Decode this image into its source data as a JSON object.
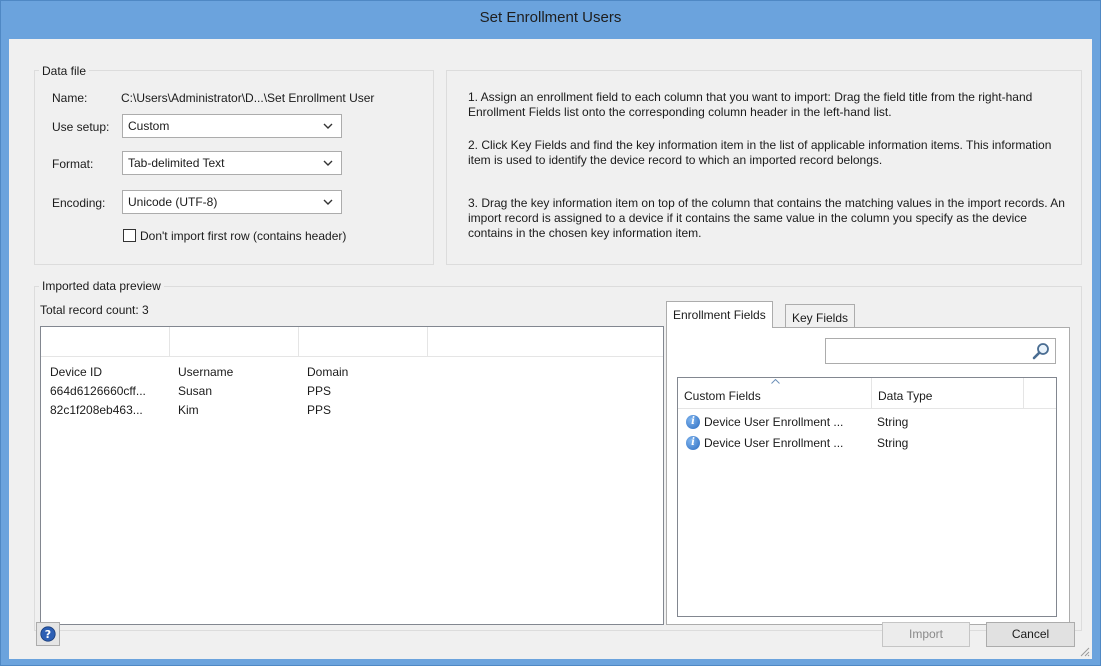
{
  "window": {
    "title": "Set Enrollment Users"
  },
  "data_file": {
    "group_title": "Data file",
    "name_label": "Name:",
    "name_value": "C:\\Users\\Administrator\\D...\\Set Enrollment User",
    "use_setup_label": "Use setup:",
    "use_setup_value": "Custom",
    "format_label": "Format:",
    "format_value": "Tab-delimited Text",
    "encoding_label": "Encoding:",
    "encoding_value": "Unicode (UTF-8)",
    "skip_header_label": "Don't import first row (contains header)",
    "skip_header_checked": false
  },
  "instructions": {
    "step1": "1. Assign an enrollment field to each column that you want to import: Drag the field title from the right-hand Enrollment Fields list onto the corresponding column header in the left-hand list.",
    "step2": "2. Click Key Fields and find the key information item in the list of applicable information items. This information item is used to identify the device record to which an imported record belongs.",
    "step3": "3. Drag the key information item on top of the column that contains the matching values in the import records. An import record is assigned to a device if it contains the same value in the column you specify as the device contains in the chosen key information item."
  },
  "preview": {
    "group_title": "Imported data preview",
    "record_count": "Total record count: 3",
    "columns": [
      "Device ID",
      "Username",
      "Domain"
    ],
    "rows": [
      [
        "664d6126660cff...",
        "Susan",
        "PPS"
      ],
      [
        "82c1f208eb463...",
        "Kim",
        "PPS"
      ]
    ]
  },
  "fields_panel": {
    "tabs": [
      "Enrollment Fields",
      "Key Fields"
    ],
    "active_tab": "Enrollment Fields",
    "search_value": "",
    "columns": [
      "Custom Fields",
      "Data Type"
    ],
    "rows": [
      {
        "icon": "info-icon",
        "name": "Device User Enrollment ...",
        "type": "String"
      },
      {
        "icon": "info-icon",
        "name": "Device User Enrollment ...",
        "type": "String"
      }
    ]
  },
  "footer": {
    "help_icon": "help-icon",
    "import_label": "Import",
    "cancel_label": "Cancel"
  },
  "colors": {
    "title_bar": "#6ba3dd",
    "client_bg": "#f0f0f0",
    "button_disabled_text": "#8a8a8a"
  }
}
